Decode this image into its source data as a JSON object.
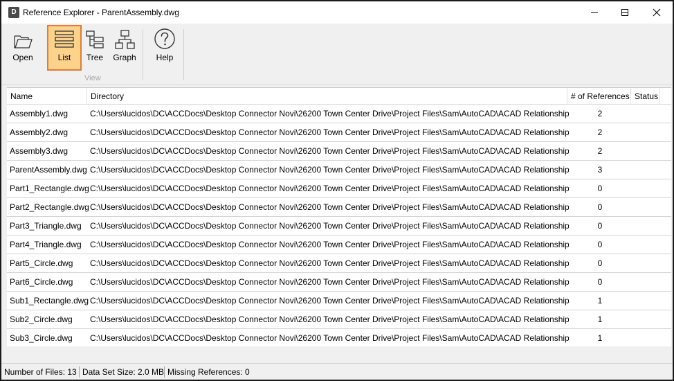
{
  "window": {
    "app_icon_letter": "D",
    "title": "Reference Explorer - ParentAssembly.dwg"
  },
  "ribbon": {
    "buttons": [
      {
        "label": "Open",
        "icon": "folder-open-icon"
      },
      {
        "label": "List",
        "icon": "list-icon",
        "active": true
      },
      {
        "label": "Tree",
        "icon": "tree-icon"
      },
      {
        "label": "Graph",
        "icon": "graph-icon"
      },
      {
        "label": "Help",
        "icon": "help-icon"
      }
    ],
    "group_label": "View",
    "active_color": "#fdd38c",
    "active_border": "#e07b39"
  },
  "grid": {
    "columns": [
      "Name",
      "Directory",
      "# of References",
      "Status"
    ],
    "rows": [
      {
        "name": "Assembly1.dwg",
        "directory": "C:\\Users\\lucidos\\DC\\ACCDocs\\Desktop Connector Novi\\26200 Town Center Drive\\Project Files\\Sam\\AutoCAD\\ACAD Relationships",
        "refs": "2",
        "status": ""
      },
      {
        "name": "Assembly2.dwg",
        "directory": "C:\\Users\\lucidos\\DC\\ACCDocs\\Desktop Connector Novi\\26200 Town Center Drive\\Project Files\\Sam\\AutoCAD\\ACAD Relationships",
        "refs": "2",
        "status": ""
      },
      {
        "name": "Assembly3.dwg",
        "directory": "C:\\Users\\lucidos\\DC\\ACCDocs\\Desktop Connector Novi\\26200 Town Center Drive\\Project Files\\Sam\\AutoCAD\\ACAD Relationships",
        "refs": "2",
        "status": ""
      },
      {
        "name": "ParentAssembly.dwg",
        "directory": "C:\\Users\\lucidos\\DC\\ACCDocs\\Desktop Connector Novi\\26200 Town Center Drive\\Project Files\\Sam\\AutoCAD\\ACAD Relationships",
        "refs": "3",
        "status": ""
      },
      {
        "name": "Part1_Rectangle.dwg",
        "directory": "C:\\Users\\lucidos\\DC\\ACCDocs\\Desktop Connector Novi\\26200 Town Center Drive\\Project Files\\Sam\\AutoCAD\\ACAD Relationships",
        "refs": "0",
        "status": ""
      },
      {
        "name": "Part2_Rectangle.dwg",
        "directory": "C:\\Users\\lucidos\\DC\\ACCDocs\\Desktop Connector Novi\\26200 Town Center Drive\\Project Files\\Sam\\AutoCAD\\ACAD Relationships",
        "refs": "0",
        "status": ""
      },
      {
        "name": "Part3_Triangle.dwg",
        "directory": "C:\\Users\\lucidos\\DC\\ACCDocs\\Desktop Connector Novi\\26200 Town Center Drive\\Project Files\\Sam\\AutoCAD\\ACAD Relationships",
        "refs": "0",
        "status": ""
      },
      {
        "name": "Part4_Triangle.dwg",
        "directory": "C:\\Users\\lucidos\\DC\\ACCDocs\\Desktop Connector Novi\\26200 Town Center Drive\\Project Files\\Sam\\AutoCAD\\ACAD Relationships",
        "refs": "0",
        "status": ""
      },
      {
        "name": "Part5_Circle.dwg",
        "directory": "C:\\Users\\lucidos\\DC\\ACCDocs\\Desktop Connector Novi\\26200 Town Center Drive\\Project Files\\Sam\\AutoCAD\\ACAD Relationships",
        "refs": "0",
        "status": ""
      },
      {
        "name": "Part6_Circle.dwg",
        "directory": "C:\\Users\\lucidos\\DC\\ACCDocs\\Desktop Connector Novi\\26200 Town Center Drive\\Project Files\\Sam\\AutoCAD\\ACAD Relationships",
        "refs": "0",
        "status": ""
      },
      {
        "name": "Sub1_Rectangle.dwg",
        "directory": "C:\\Users\\lucidos\\DC\\ACCDocs\\Desktop Connector Novi\\26200 Town Center Drive\\Project Files\\Sam\\AutoCAD\\ACAD Relationships",
        "refs": "1",
        "status": ""
      },
      {
        "name": "Sub2_Circle.dwg",
        "directory": "C:\\Users\\lucidos\\DC\\ACCDocs\\Desktop Connector Novi\\26200 Town Center Drive\\Project Files\\Sam\\AutoCAD\\ACAD Relationships",
        "refs": "1",
        "status": ""
      },
      {
        "name": "Sub3_Circle.dwg",
        "directory": "C:\\Users\\lucidos\\DC\\ACCDocs\\Desktop Connector Novi\\26200 Town Center Drive\\Project Files\\Sam\\AutoCAD\\ACAD Relationships",
        "refs": "1",
        "status": ""
      }
    ]
  },
  "statusbar": {
    "files": "Number of Files: 13",
    "size": "Data Set Size: 2.0 MB",
    "missing": "Missing References: 0"
  }
}
